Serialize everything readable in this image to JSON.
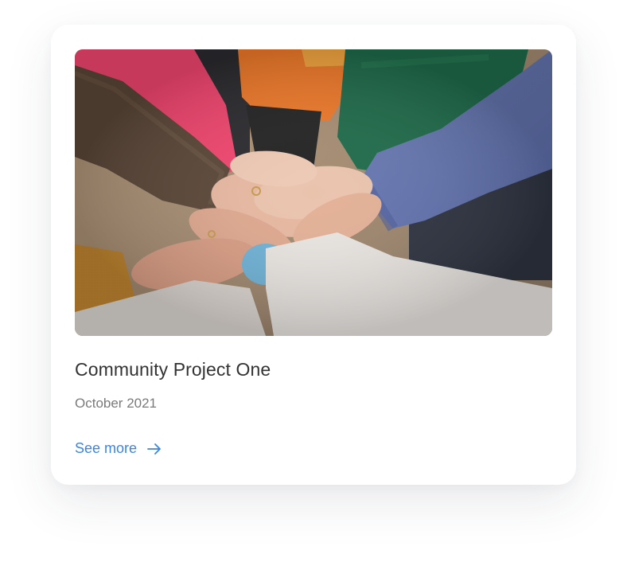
{
  "card": {
    "image_icon": "people-stacking-hands-photo",
    "title": "Community Project One",
    "date": "October 2021",
    "link_label": "See more",
    "link_icon": "arrow-right-icon"
  },
  "colors": {
    "title": "#333333",
    "date": "#7a7a7a",
    "link": "#3d85e0",
    "card_background": "#ffffff"
  }
}
